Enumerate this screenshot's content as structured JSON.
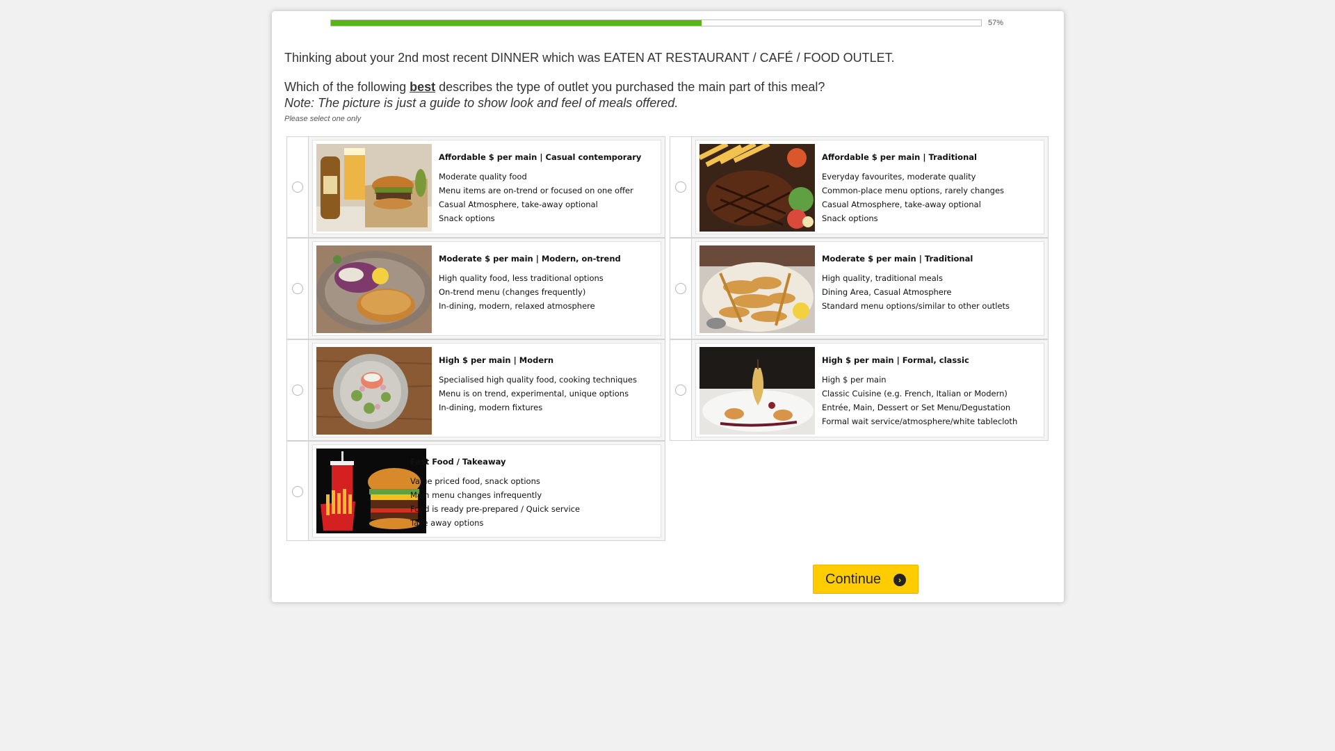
{
  "progress": {
    "percent_label": "57%",
    "value": 0.57
  },
  "question": {
    "context": "Thinking about your 2nd most recent DINNER which was EATEN AT RESTAURANT / CAFÉ / FOOD OUTLET.",
    "main_prefix": "Which of the following ",
    "main_emphasis": "best",
    "main_suffix": " describes the type of outlet you purchased the main part of this meal?",
    "note": "Note: The picture is just a guide to show look and feel of meals offered.",
    "hint": "Please select one only"
  },
  "options": [
    {
      "title": "Affordable $ per main | Casual contemporary",
      "lines": [
        "Moderate quality food",
        "Menu items are on-trend or focused on one offer",
        "Casual Atmosphere, take-away optional",
        "Snack options"
      ],
      "photo": "burger-box-and-beer-photo"
    },
    {
      "title": "Affordable $ per main | Traditional",
      "lines": [
        "Everyday favourites, moderate quality",
        "Common-place menu options, rarely changes",
        "Casual Atmosphere, take-away optional",
        "Snack options"
      ],
      "photo": "steak-and-chips-photo"
    },
    {
      "title": "Moderate $ per main | Modern, on-trend",
      "lines": [
        "High quality food, less traditional options",
        "On-trend menu (changes frequently)",
        "In-dining, modern, relaxed atmosphere"
      ],
      "photo": "schnitzel-slaw-plate-photo"
    },
    {
      "title": "Moderate $ per main | Traditional",
      "lines": [
        "High quality, traditional meals",
        "Dining Area, Casual Atmosphere",
        "Standard menu options/similar to other outlets"
      ],
      "photo": "seafood-basket-photo"
    },
    {
      "title": "High $ per main | Modern",
      "lines": [
        "Specialised high quality food, cooking techniques",
        "Menu is on trend, experimental, unique options",
        "In-dining, modern fixtures"
      ],
      "photo": "salad-bowl-on-wood-photo"
    },
    {
      "title": "High $ per main | Formal, classic",
      "lines": [
        "High $ per main",
        "Classic Cuisine (e.g. French, Italian or Modern)",
        "Entrée, Main, Dessert or Set Menu/Degustation",
        "Formal wait service/atmosphere/white tablecloth"
      ],
      "photo": "fine-dining-dessert-photo"
    },
    {
      "title": "Fast Food / Takeaway",
      "lines": [
        "Value priced food, snack options",
        "Main menu changes infrequently",
        "Food is ready pre-prepared / Quick service",
        "Take away options"
      ],
      "photo": "burger-fries-soda-photo"
    }
  ],
  "continue_label": "Continue",
  "colors": {
    "progress": "#5bb219",
    "button": "#ffcc00"
  }
}
